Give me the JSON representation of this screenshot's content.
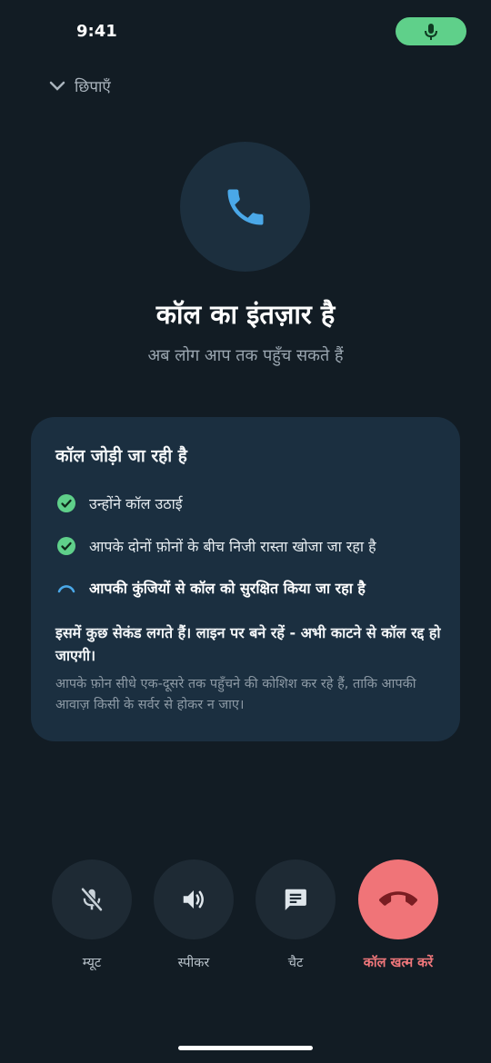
{
  "status_bar": {
    "time": "9:41",
    "mic_icon": "mic-icon",
    "pill_color": "#5fd08a"
  },
  "header": {
    "hide_label": "छिपाएँ",
    "chevron_icon": "chevron-down-icon"
  },
  "call": {
    "avatar_icon": "phone-icon",
    "title": "कॉल का इंतज़ार है",
    "subtitle": "अब लोग आप तक पहुँच सकते हैं"
  },
  "status_card": {
    "title": "कॉल जोड़ी जा रही है",
    "steps": [
      {
        "label": "उन्होंने कॉल उठाई",
        "state": "done",
        "icon": "check-circle-icon"
      },
      {
        "label": "आपके दोनों फ़ोनों के बीच निजी रास्ता खोजा जा रहा है",
        "state": "done",
        "icon": "check-circle-icon"
      },
      {
        "label": "आपकी कुंजियों से कॉल को सुरक्षित किया जा रहा है",
        "state": "in-progress",
        "icon": "spinner-icon"
      }
    ],
    "note_strong": "इसमें कुछ सेकंड लगते हैं। लाइन पर बने रहें - अभी काटने से कॉल रद्द हो जाएगी।",
    "note_muted": "आपके फ़ोन सीधे एक-दूसरे तक पहुँचने की कोशिश कर रहे हैं, ताकि आपकी आवाज़ किसी के सर्वर से होकर न जाए।"
  },
  "controls": {
    "mute": {
      "label": "म्यूट",
      "icon": "mic-off-icon"
    },
    "speaker": {
      "label": "स्पीकर",
      "icon": "speaker-icon"
    },
    "chat": {
      "label": "चैट",
      "icon": "chat-icon"
    },
    "end_call": {
      "label": "कॉल खत्म करें",
      "icon": "hang-up-icon",
      "color": "#f07478"
    }
  },
  "colors": {
    "background": "#121c24",
    "card": "#1b2f40",
    "accent_green": "#5fd08a",
    "accent_blue": "#4aa8e8"
  }
}
